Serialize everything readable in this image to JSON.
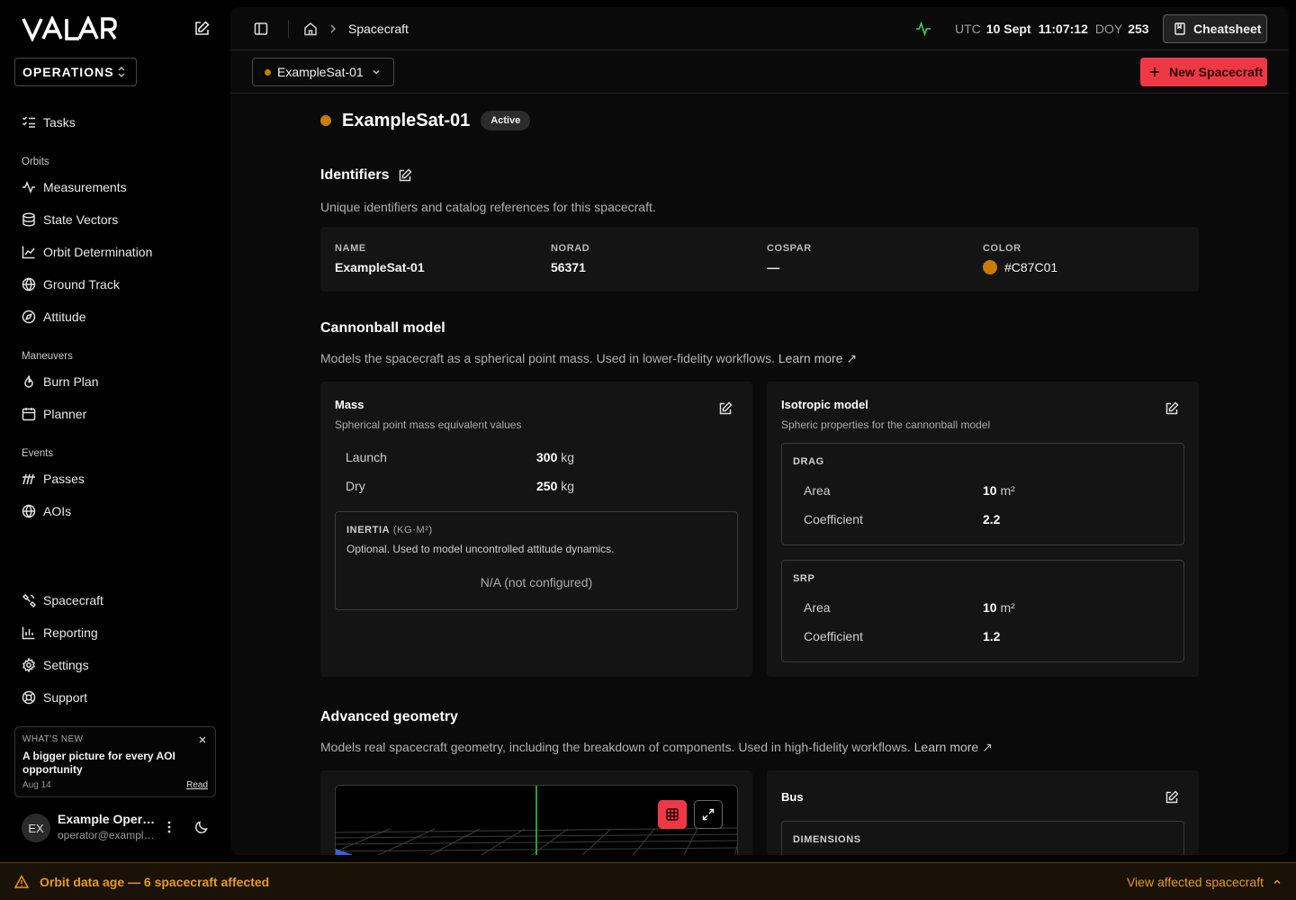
{
  "colors": {
    "accent": "#EF3846",
    "spacecraft": "#C87C01",
    "status_ok": "#3FCF6E",
    "warning": "#E79A1E"
  },
  "sidebar": {
    "logo": "VALAR",
    "workspace": "OPERATIONS",
    "tasks": "Tasks",
    "sections": [
      {
        "title": "Orbits",
        "items": [
          {
            "label": "Measurements",
            "icon": "activity-icon"
          },
          {
            "label": "State Vectors",
            "icon": "database-icon"
          },
          {
            "label": "Orbit Determination",
            "icon": "line-chart-icon"
          },
          {
            "label": "Ground Track",
            "icon": "globe-icon"
          },
          {
            "label": "Attitude",
            "icon": "compass-icon"
          }
        ]
      },
      {
        "title": "Maneuvers",
        "items": [
          {
            "label": "Burn Plan",
            "icon": "flame-icon"
          },
          {
            "label": "Planner",
            "icon": "calendar-icon"
          }
        ]
      },
      {
        "title": "Events",
        "items": [
          {
            "label": "Passes",
            "icon": "signal-icon"
          },
          {
            "label": "AOIs",
            "icon": "globe-icon"
          }
        ]
      }
    ],
    "bottom_items": [
      {
        "label": "Spacecraft",
        "icon": "satellite-icon"
      },
      {
        "label": "Reporting",
        "icon": "bar-chart-icon"
      },
      {
        "label": "Settings",
        "icon": "gear-icon"
      },
      {
        "label": "Support",
        "icon": "lifebuoy-icon"
      }
    ],
    "news": {
      "kicker": "WHAT'S NEW",
      "headline": "A bigger picture for every AOI opportunity",
      "date": "Aug 14",
      "read": "Read"
    },
    "user": {
      "initials": "EX",
      "name": "Example Operator",
      "email": "operator@example.com"
    }
  },
  "topbar": {
    "breadcrumb": "Spacecraft",
    "clock": {
      "utc_label": "UTC",
      "date": "10 Sept",
      "time": "11:07:12",
      "doy_label": "DOY",
      "doy": "253"
    },
    "cheatsheet": "Cheatsheet"
  },
  "subbar": {
    "selected_spacecraft": "ExampleSat-01",
    "new_button": "New Spacecraft"
  },
  "spacecraft": {
    "name": "ExampleSat-01",
    "status": "Active",
    "identifiers": {
      "title": "Identifiers",
      "description": "Unique identifiers and catalog references for this spacecraft.",
      "fields": [
        {
          "label": "NAME",
          "value": "ExampleSat-01"
        },
        {
          "label": "NORAD",
          "value": "56371"
        },
        {
          "label": "COSPAR",
          "value": "—"
        },
        {
          "label": "COLOR",
          "value": "#C87C01"
        }
      ]
    },
    "cannonball": {
      "title": "Cannonball model",
      "description": "Models the spacecraft as a spherical point mass. Used in lower-fidelity workflows.",
      "learn_more": "Learn more ↗",
      "mass": {
        "title": "Mass",
        "subtitle": "Spherical point mass equivalent values",
        "rows": [
          {
            "label": "Launch",
            "value": "300",
            "unit": "kg"
          },
          {
            "label": "Dry",
            "value": "250",
            "unit": "kg"
          }
        ],
        "inertia": {
          "label": "INERTIA",
          "unit": "(KG·M²)",
          "description": "Optional. Used to model uncontrolled attitude dynamics.",
          "value": "N/A (not configured)"
        }
      },
      "isotropic": {
        "title": "Isotropic model",
        "subtitle": "Spheric properties for the cannonball model",
        "drag": {
          "label": "DRAG",
          "area_label": "Area",
          "area": "10",
          "area_unit": "m²",
          "coef_label": "Coefficient",
          "coef": "2.2"
        },
        "srp": {
          "label": "SRP",
          "area_label": "Area",
          "area": "10",
          "area_unit": "m²",
          "coef_label": "Coefficient",
          "coef": "1.2"
        }
      }
    },
    "advanced": {
      "title": "Advanced geometry",
      "description": "Models real spacecraft geometry, including the breakdown of components. Used in high-fidelity workflows.",
      "learn_more": "Learn more ↗",
      "bus": {
        "title": "Bus",
        "dimensions": "DIMENSIONS"
      }
    }
  },
  "banner": {
    "text": "Orbit data age — 6 spacecraft affected",
    "link": "View affected spacecraft"
  }
}
